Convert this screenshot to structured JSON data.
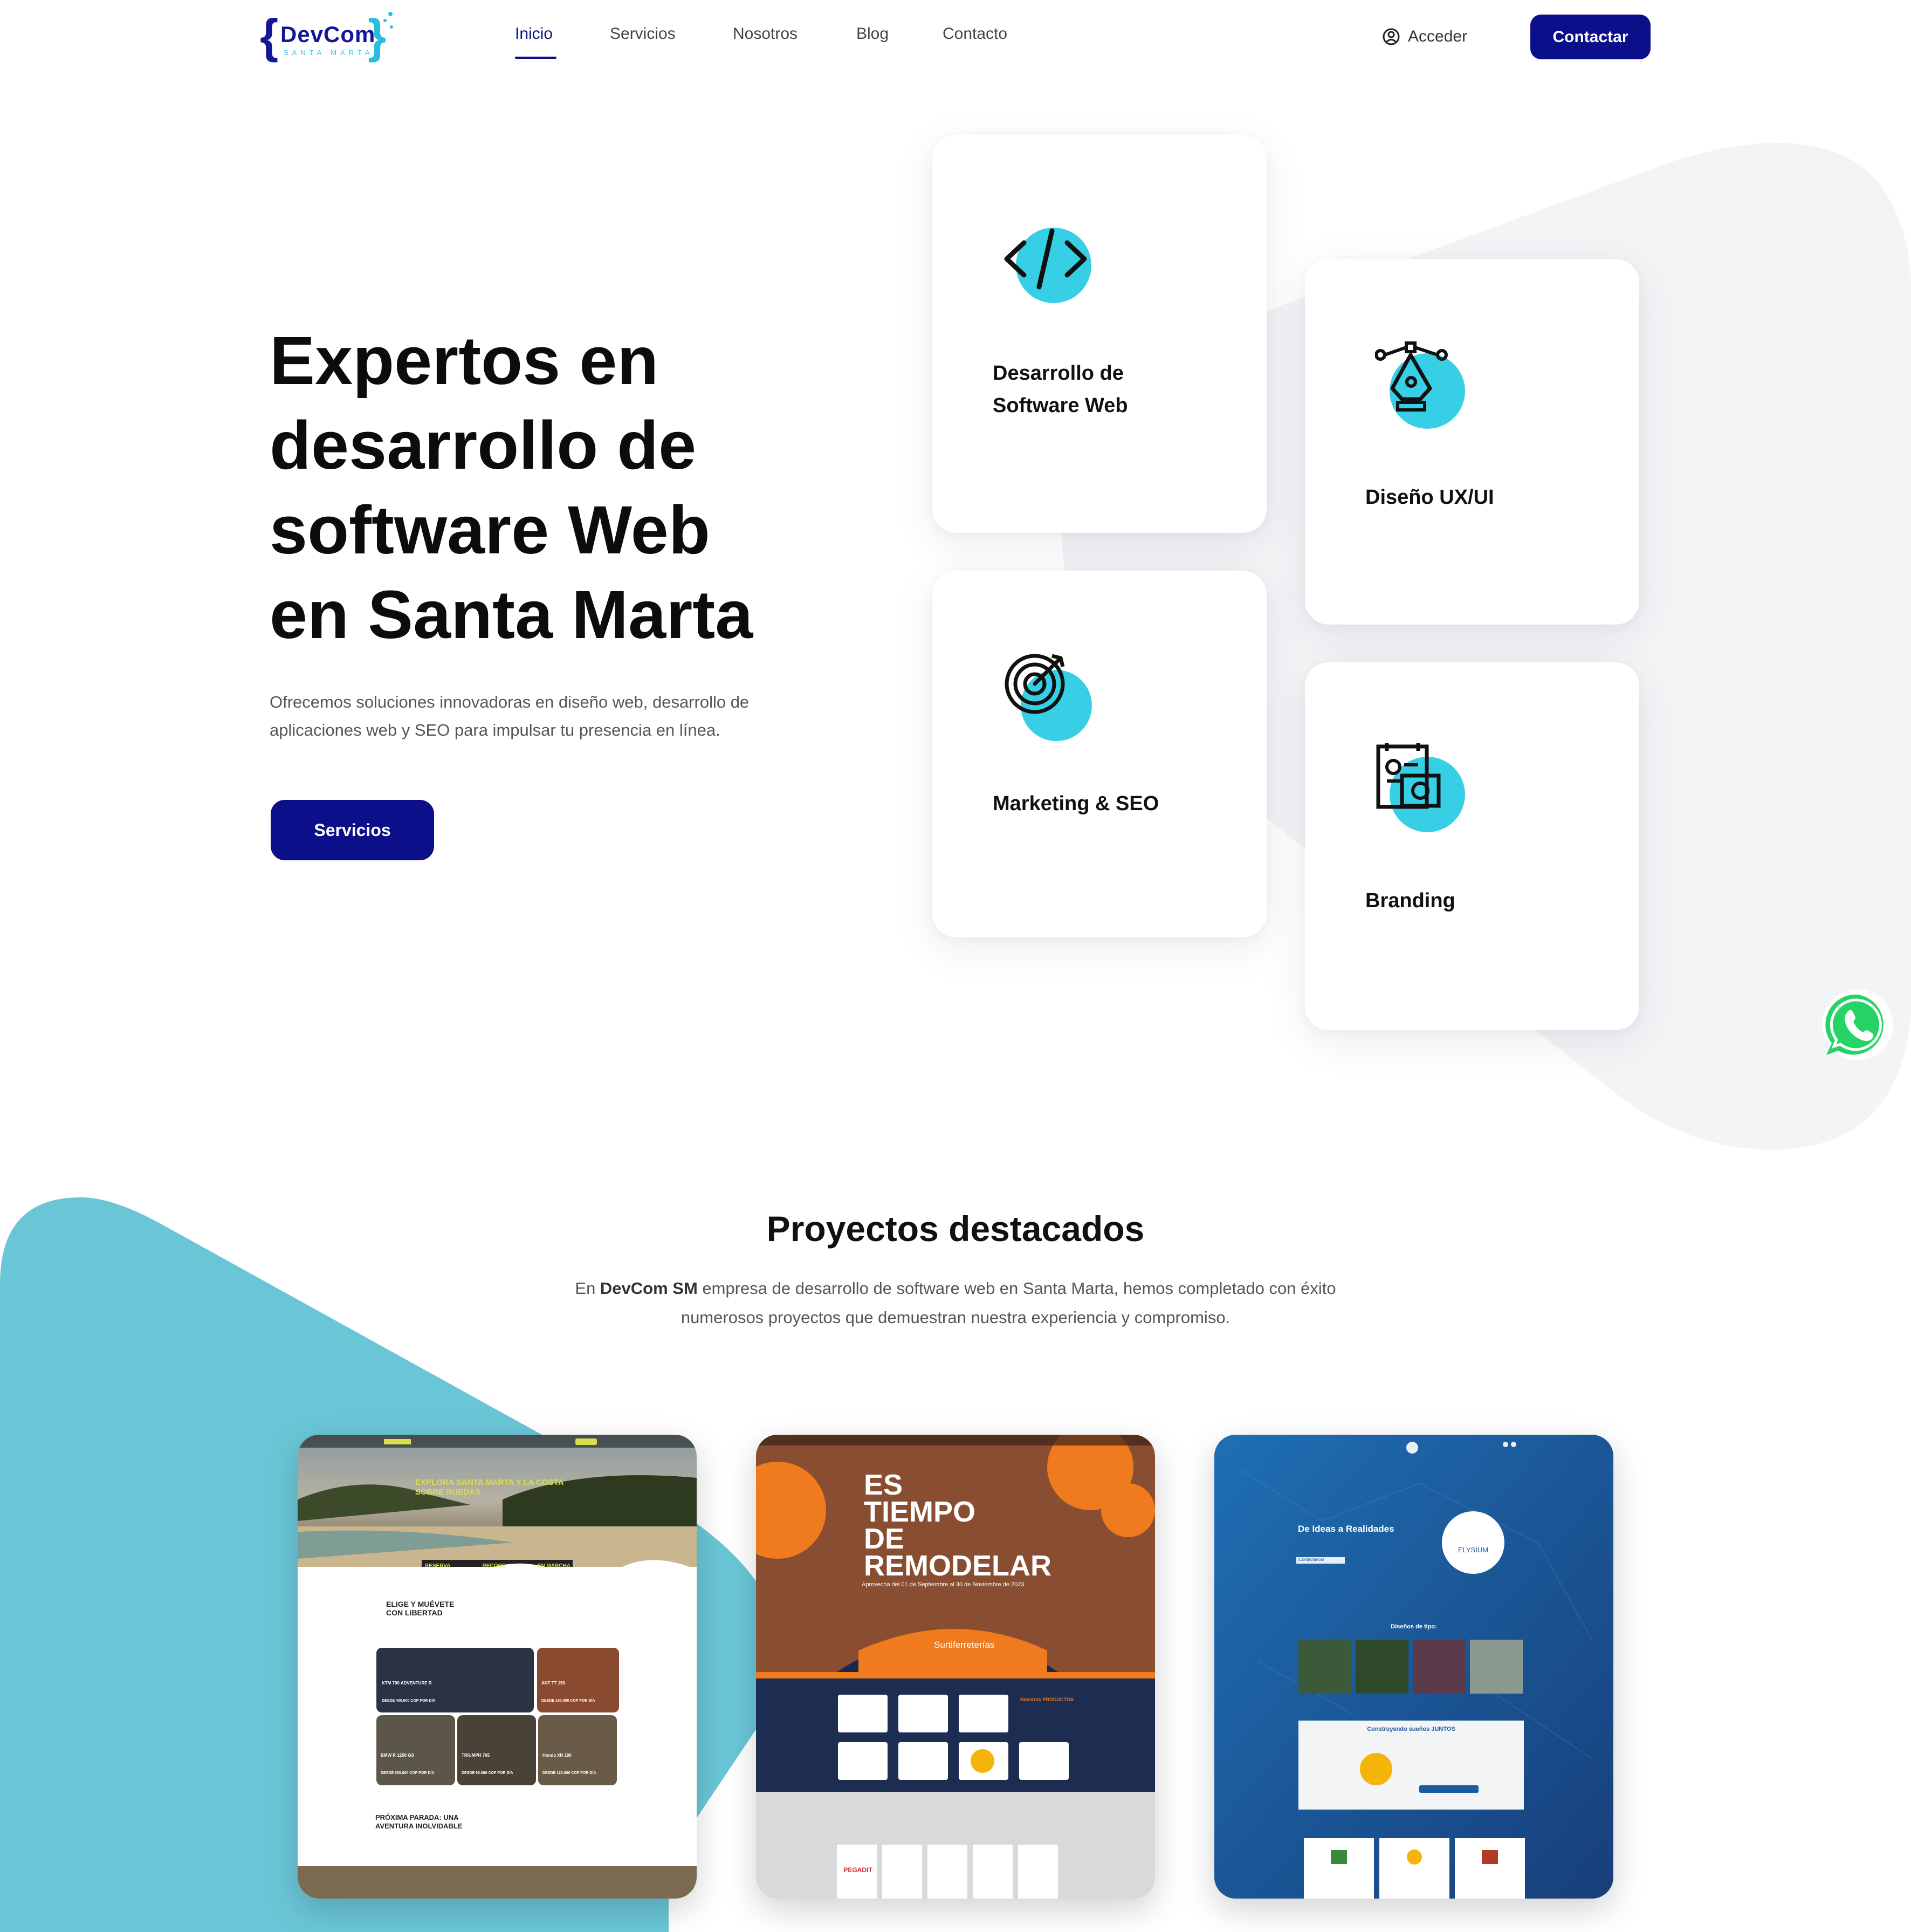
{
  "brand": {
    "name": "DevCom",
    "tagline": "SANTA MARTA",
    "brace_open": "{",
    "brace_close": "}"
  },
  "nav": {
    "items": [
      {
        "label": "Inicio",
        "active": true
      },
      {
        "label": "Servicios",
        "active": false
      },
      {
        "label": "Nosotros",
        "active": false
      },
      {
        "label": "Blog",
        "active": false
      },
      {
        "label": "Contacto",
        "active": false
      }
    ],
    "login_label": "Acceder",
    "login_icon": "user-circle-icon",
    "contact_label": "Contactar"
  },
  "hero": {
    "title_lines": [
      "Expertos en",
      "desarrollo de",
      "software Web",
      "en Santa Marta"
    ],
    "subtitle_lines": [
      "Ofrecemos soluciones innovadoras en diseño web, desarrollo de",
      "aplicaciones web y SEO para impulsar tu presencia en línea."
    ],
    "cta_label": "Servicios"
  },
  "services": [
    {
      "title_lines": [
        "Desarrollo de",
        "Software Web"
      ],
      "icon": "code-icon"
    },
    {
      "title_lines": [
        "Diseño UX/UI"
      ],
      "icon": "pen-tool-icon"
    },
    {
      "title_lines": [
        "Marketing & SEO"
      ],
      "icon": "target-icon"
    },
    {
      "title_lines": [
        "Branding"
      ],
      "icon": "branding-icon"
    }
  ],
  "projects": {
    "title": "Proyectos destacados",
    "desc_prefix": "En ",
    "desc_brand": "DevCom SM",
    "desc_line1_rest": " empresa de desarrollo de software web en Santa Marta, hemos completado con éxito",
    "desc_line2": "numerosos proyectos que demuestran nuestra experiencia y compromiso.",
    "items": [
      {
        "headline": "EXPLORA SANTA MARTA Y LA COSTA SOBRE RUEDAS",
        "tabs": [
          "RESERVA",
          "RECOGE",
          "EN MARCHA"
        ],
        "section_title": "ELIGE Y MUÉVETE CON LIBERTAD",
        "footer_title": "PRÓXIMA PARADA: UNA AVENTURA INOLVIDABLE",
        "products": [
          "KTM 790 ADVENTURE R",
          "AKT TT 150",
          "BMW R 1250 GS",
          "TRIUMPH 765",
          "Honda XR 190"
        ],
        "prices": [
          "DESDE 400.000 COP POR DÍA",
          "DESDE 100.000 COP POR DÍA",
          "DESDE 350.000 COP POR DÍA",
          "DESDE 90.000 COP POR DÍA",
          "DESDE 120.000 COP POR DÍA"
        ]
      },
      {
        "headline_lines": [
          "ES",
          "TIEMPO",
          "DE",
          "REMODELAR"
        ],
        "promo": "Aprovecha del 01 de Septiembre al 30 de Noviembre de 2023",
        "brand": "Surtiferreterías",
        "products_label": "Nuestros PRODUCTOS",
        "partner": "PEGADIT"
      },
      {
        "headline": "De Ideas a Realidades",
        "logo_text": "ELYSIUM",
        "design_label": "Diseños de tipo:",
        "build_label": "Construyendo sueños JUNTOS",
        "cta": "¡Contáctanos!"
      }
    ]
  },
  "colors": {
    "primary": "#0b0f8a",
    "accent": "#36cfe6",
    "teal_shape": "#6ac6d6",
    "whatsapp": "#25d366"
  }
}
